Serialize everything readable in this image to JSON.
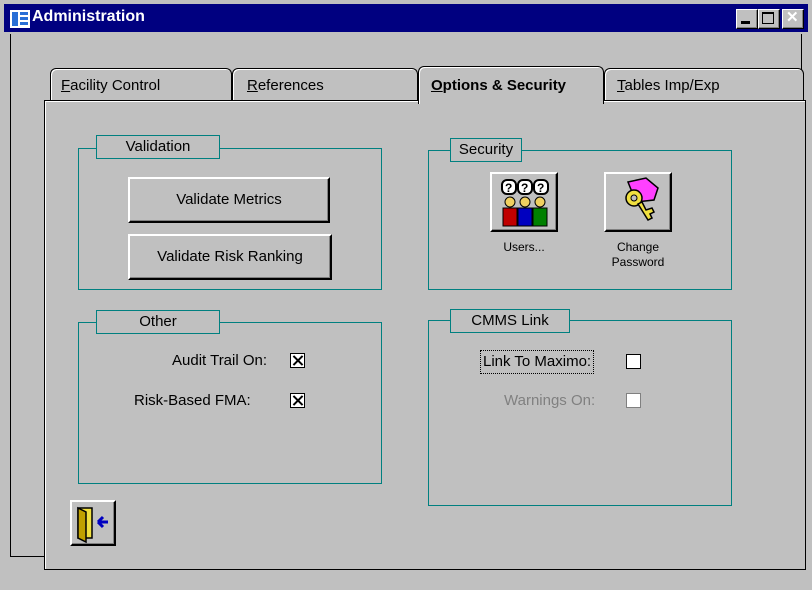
{
  "window": {
    "title": "Administration"
  },
  "tabs": [
    {
      "label": "Facility Control",
      "accel": "F",
      "rest": "acility Control",
      "active": false
    },
    {
      "label": "References",
      "accel": "R",
      "rest": "eferences",
      "active": false
    },
    {
      "label": "Options & Security",
      "accel": "O",
      "rest": "ptions & Security",
      "active": true
    },
    {
      "label": "Tables Imp/Exp",
      "accel": "T",
      "rest": "ables Imp/Exp",
      "active": false
    }
  ],
  "validation": {
    "title": "Validation",
    "validate_metrics_label": "Validate Metrics",
    "validate_risk_label": "Validate Risk Ranking"
  },
  "security": {
    "title": "Security",
    "users_label": "Users...",
    "change_password_label_line1": "Change",
    "change_password_label_line2": "Password"
  },
  "other": {
    "title": "Other",
    "audit_trail_label": "Audit Trail On:",
    "audit_trail_checked": true,
    "risk_fma_label": "Risk-Based FMA:",
    "risk_fma_checked": true
  },
  "cmms": {
    "title": "CMMS Link",
    "link_maximo_label": "Link To Maximo:",
    "link_maximo_checked": false,
    "warnings_label": "Warnings On:",
    "warnings_checked": false,
    "warnings_enabled": false
  },
  "colors": {
    "title_bar": "#000080",
    "group_border": "#008080",
    "disabled_text": "#808080"
  }
}
